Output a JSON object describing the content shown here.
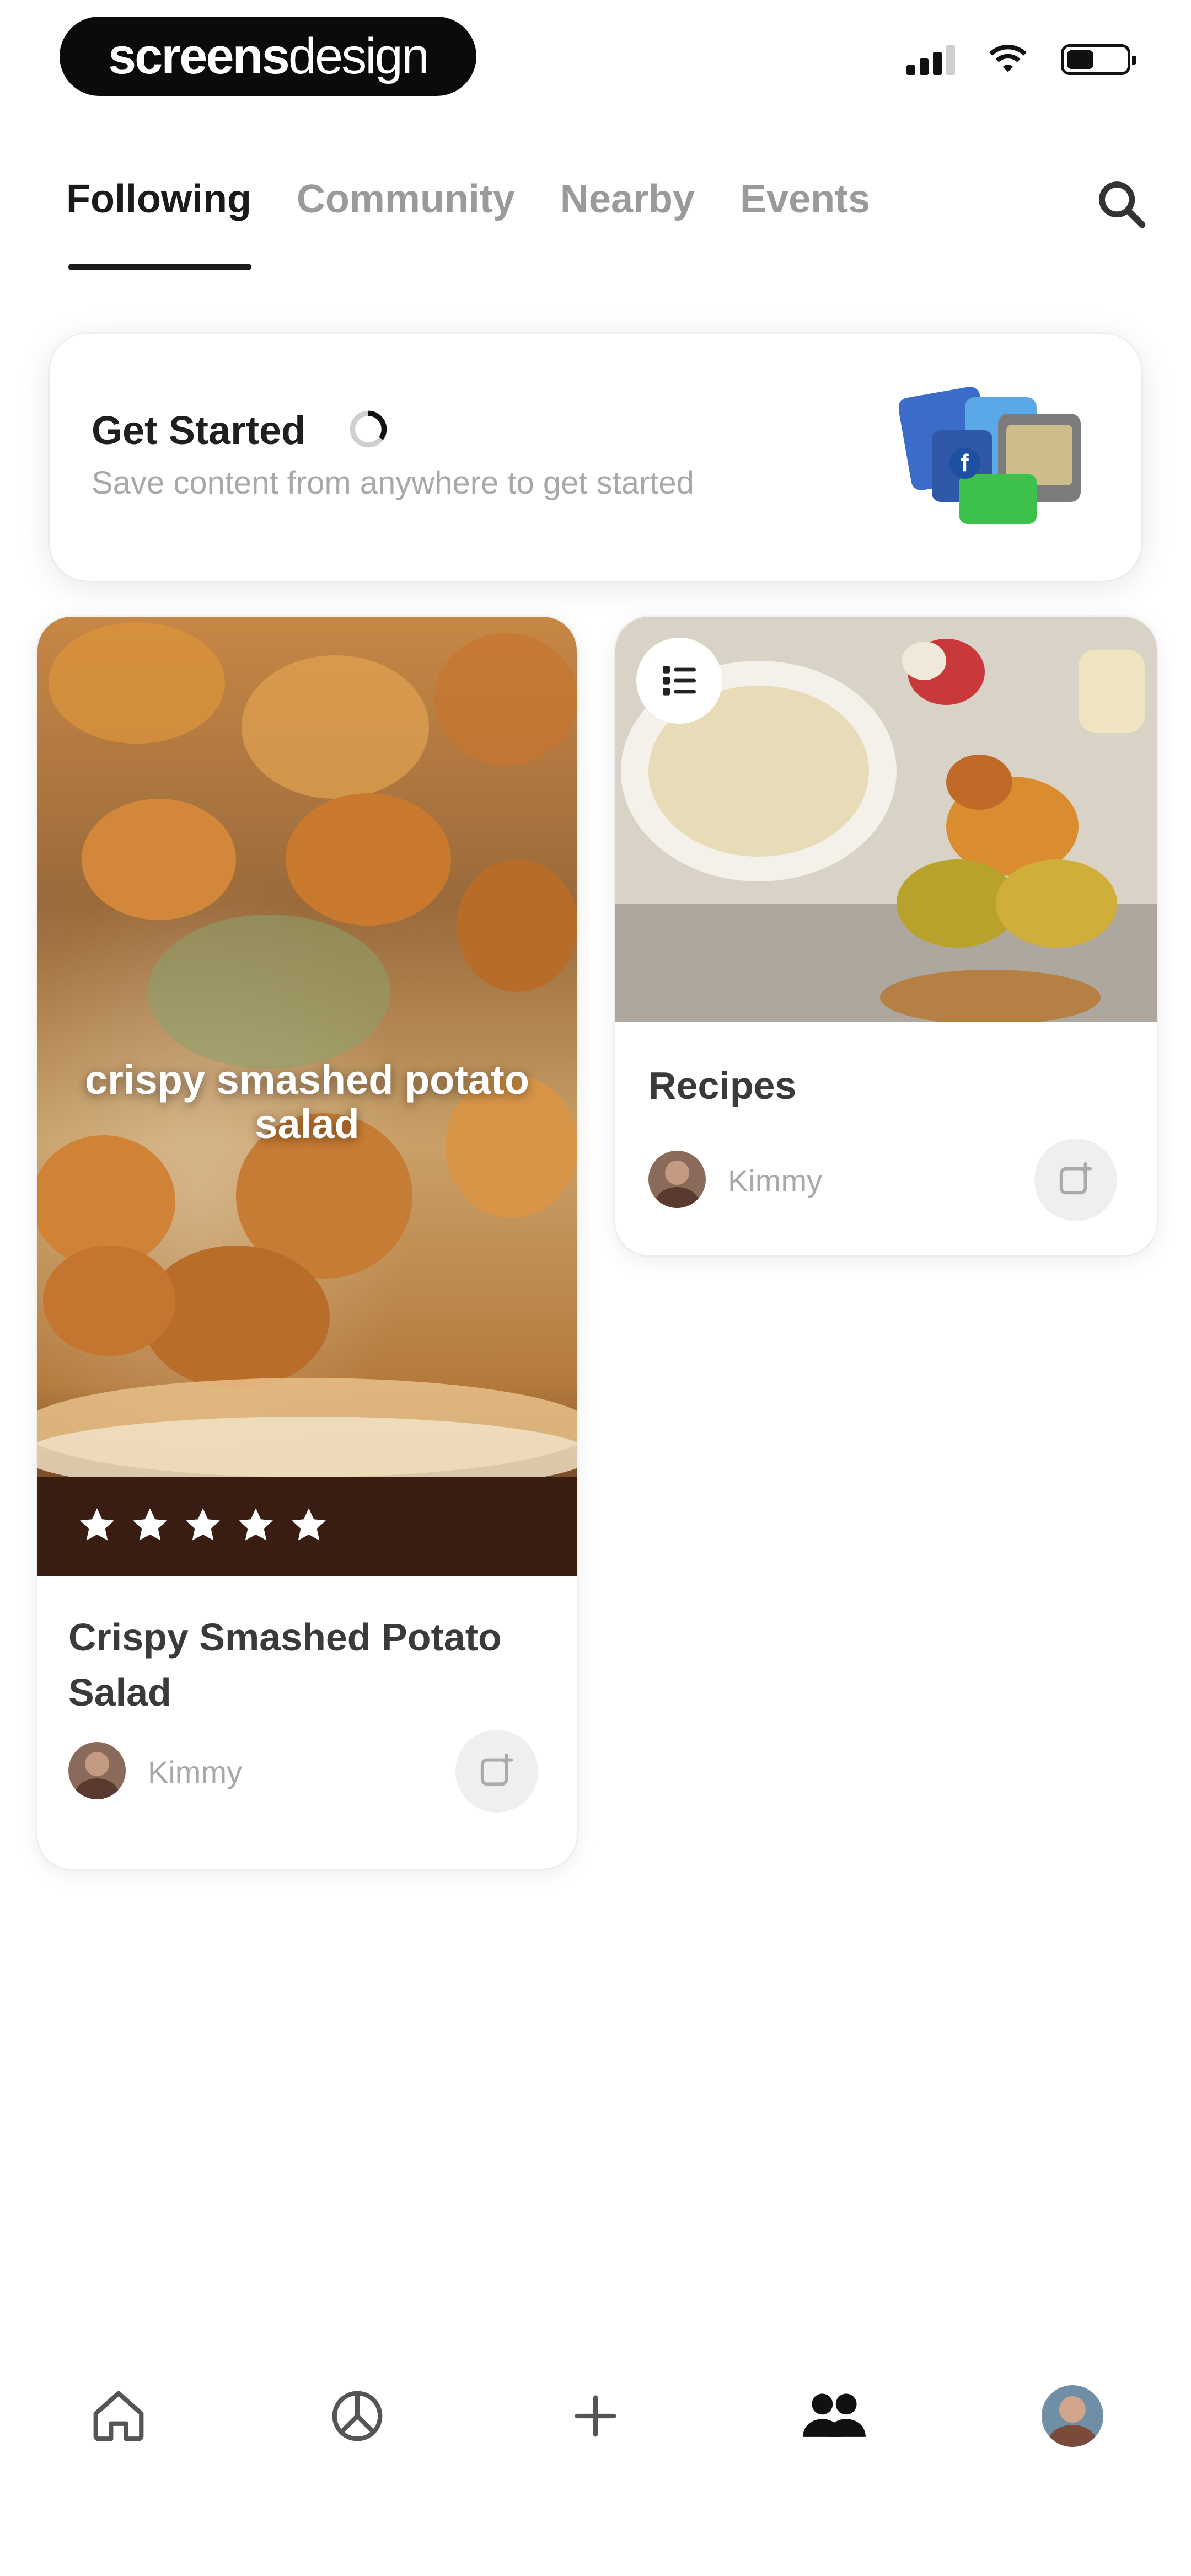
{
  "status_bar": {
    "logo_primary": "screens",
    "logo_secondary": "design",
    "signal_icon": "cellular-signal-icon",
    "wifi_icon": "wifi-icon",
    "battery_icon": "battery-icon",
    "battery_level": 0.45
  },
  "tabs": [
    {
      "label": "Following",
      "active": true
    },
    {
      "label": "Community",
      "active": false
    },
    {
      "label": "Nearby",
      "active": false
    },
    {
      "label": "Events",
      "active": false
    }
  ],
  "search_icon": "search-icon",
  "get_started": {
    "title": "Get Started",
    "subtitle": "Save content from anywhere to get started",
    "progress_icon": "progress-ring-icon",
    "progress": 0.35
  },
  "cards": [
    {
      "image_caption": "crispy smashed potato salad",
      "rating": 5,
      "title": "Crispy Smashed Potato Salad",
      "author": "Kimmy",
      "save_icon": "bookmark-add-icon"
    },
    {
      "badge_icon": "list-icon",
      "title": "Recipes",
      "author": "Kimmy",
      "save_icon": "bookmark-add-icon"
    }
  ],
  "bottom_nav": [
    {
      "icon": "home-icon"
    },
    {
      "icon": "explore-icon"
    },
    {
      "icon": "plus-icon"
    },
    {
      "icon": "people-icon",
      "active": true
    },
    {
      "icon": "profile-avatar-icon"
    }
  ],
  "colors": {
    "text_primary": "#1a1a1a",
    "text_muted": "#9a9a9a",
    "card_bg": "#ffffff",
    "logo_pill": "#0b0b0b"
  }
}
